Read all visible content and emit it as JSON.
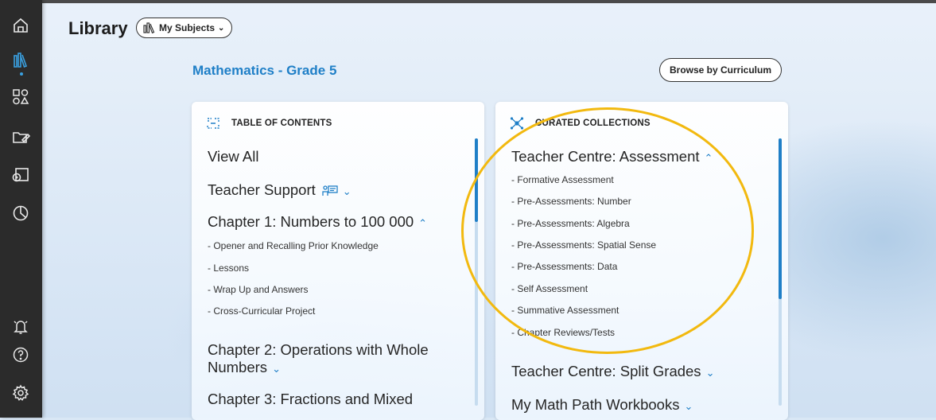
{
  "sidebar": {
    "items": [
      {
        "name": "home-icon"
      },
      {
        "name": "library-icon"
      },
      {
        "name": "shapes-icon"
      },
      {
        "name": "folder-edit-icon"
      },
      {
        "name": "assign-icon"
      },
      {
        "name": "reports-icon"
      },
      {
        "name": "notification-bell-icon"
      },
      {
        "name": "help-icon"
      },
      {
        "name": "settings-icon"
      }
    ],
    "active": "library-icon"
  },
  "header": {
    "title": "Library",
    "subjects_button": "My Subjects",
    "subject_heading": "Mathematics - Grade 5",
    "browse_button": "Browse by Curriculum"
  },
  "toc": {
    "heading": "TABLE OF CONTENTS",
    "view_all": "View All",
    "teacher_support": "Teacher Support",
    "chapter1": "Chapter 1: Numbers to 100 000",
    "chapter1_items": [
      "- Opener and Recalling Prior Knowledge",
      "- Lessons",
      "- Wrap Up and Answers",
      "- Cross-Curricular Project"
    ],
    "chapter2_line1": "Chapter 2: Operations with Whole",
    "chapter2_line2": "Numbers",
    "chapter3": "Chapter 3: Fractions and Mixed"
  },
  "curated": {
    "heading": "CURATED COLLECTIONS",
    "assessment": "Teacher Centre: Assessment",
    "assessment_items": [
      "- Formative Assessment",
      "- Pre-Assessments: Number",
      "- Pre-Assessments: Algebra",
      "- Pre-Assessments: Spatial Sense",
      "- Pre-Assessments: Data",
      "- Self Assessment",
      "- Summative Assessment",
      "- Chapter Reviews/Tests"
    ],
    "split_grades": "Teacher Centre: Split Grades",
    "workbooks": "My Math Path Workbooks"
  },
  "colors": {
    "accent": "#1f7fc7",
    "sidebar": "#2b2b2b",
    "highlight": "#f2b90f"
  }
}
